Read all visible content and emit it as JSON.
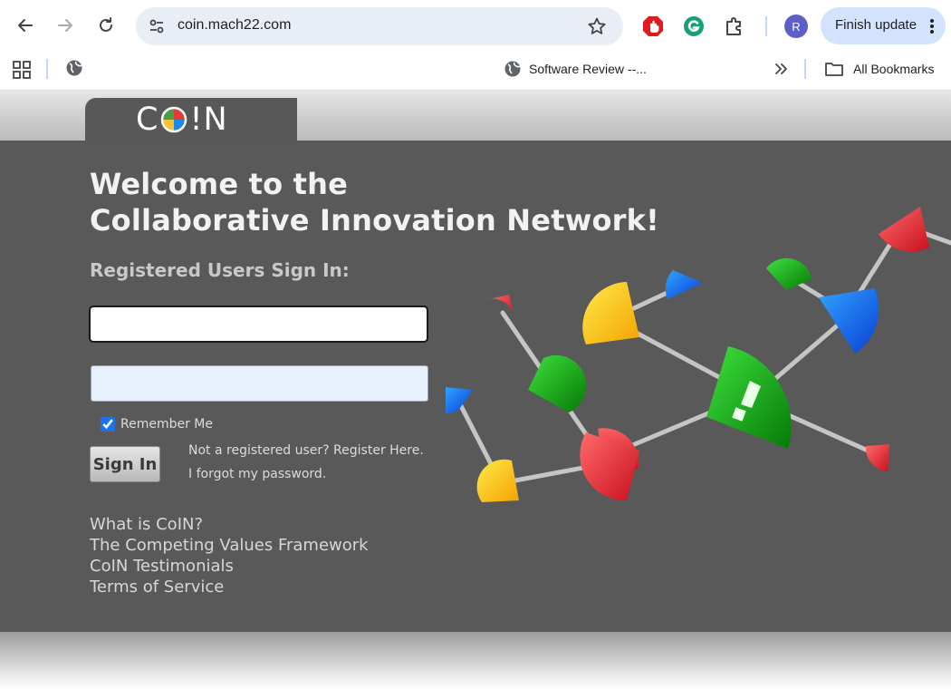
{
  "browser": {
    "url": "coin.mach22.com",
    "avatar_letter": "R",
    "finish_update_label": "Finish update",
    "bookmark_item": "Software Review --...",
    "all_bookmarks_label": "All Bookmarks"
  },
  "site": {
    "logo_left": "C",
    "logo_right": "!N",
    "welcome_line1": "Welcome to the",
    "welcome_line2": "Collaborative Innovation Network!",
    "signin_heading": "Registered Users Sign In:",
    "username_value": "",
    "password_value": "",
    "remember_me_label": "Remember Me",
    "remember_me_checked": true,
    "signin_button": "Sign In",
    "register_link": "Not a registered user? Register Here.",
    "forgot_link": "I forgot my password.",
    "footer_links": [
      "What is CoIN?",
      "The Competing Values Framework",
      "CoIN Testimonials",
      "Terms of Service"
    ]
  },
  "colors": {
    "panel": "#595959",
    "chrome_blue": "#d3e3fd",
    "omnibox": "#e9eef6"
  }
}
